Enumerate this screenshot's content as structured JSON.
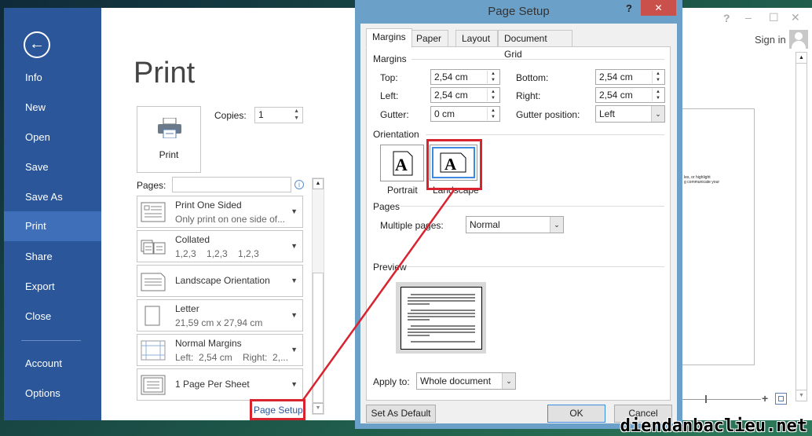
{
  "sidebar": {
    "items": [
      {
        "label": "Info"
      },
      {
        "label": "New"
      },
      {
        "label": "Open"
      },
      {
        "label": "Save"
      },
      {
        "label": "Save As"
      },
      {
        "label": "Print",
        "active": true
      },
      {
        "label": "Share"
      },
      {
        "label": "Export"
      },
      {
        "label": "Close"
      },
      {
        "label": "Account"
      },
      {
        "label": "Options"
      }
    ]
  },
  "print": {
    "title": "Print",
    "print_button": "Print",
    "copies_label": "Copies:",
    "copies_value": "1",
    "pages_label": "Pages:",
    "pages_value": "",
    "settings": [
      {
        "l1": "Print One Sided",
        "l2": "Only print on one side of..."
      },
      {
        "l1": "Collated",
        "l2": "1,2,3    1,2,3    1,2,3"
      },
      {
        "l1": "Landscape Orientation",
        "l2": ""
      },
      {
        "l1": "Letter",
        "l2": "21,59 cm x 27,94 cm"
      },
      {
        "l1": "Normal Margins",
        "l2": "Left:  2,54 cm    Right:  2,..."
      },
      {
        "l1": "1 Page Per Sheet",
        "l2": ""
      }
    ],
    "page_setup_link": "Page Setup"
  },
  "dialog": {
    "title": "Page Setup",
    "help": "?",
    "close": "✕",
    "tabs": [
      "Margins",
      "Paper",
      "Layout",
      "Document Grid"
    ],
    "margins_group": "Margins",
    "top_label": "Top:",
    "top": "2,54 cm",
    "bottom_label": "Bottom:",
    "bottom": "2,54 cm",
    "left_label": "Left:",
    "left": "2,54 cm",
    "right_label": "Right:",
    "right": "2,54 cm",
    "gutter_label": "Gutter:",
    "gutter": "0 cm",
    "gutter_pos_label": "Gutter position:",
    "gutter_pos": "Left",
    "orientation_group": "Orientation",
    "portrait": "Portrait",
    "landscape": "Landscape",
    "selected_orientation": "Landscape",
    "pages_group": "Pages",
    "multiple_pages_label": "Multiple pages:",
    "multiple_pages": "Normal",
    "preview_group": "Preview",
    "apply_to_label": "Apply to:",
    "apply_to": "Whole document",
    "set_default": "Set As Default",
    "ok": "OK",
    "cancel": "Cancel"
  },
  "window": {
    "help": "?",
    "minimize": "–",
    "maximize": "☐",
    "close": "✕",
    "sign_in": "Sign in",
    "preview_text1": "les, or highlight",
    "preview_text2": "g communicate your"
  },
  "watermark": "diendanbaclieu.net",
  "colors": {
    "accent": "#2b579a",
    "annotation": "#d9232e",
    "dialog_frame": "#6ba0c8"
  }
}
